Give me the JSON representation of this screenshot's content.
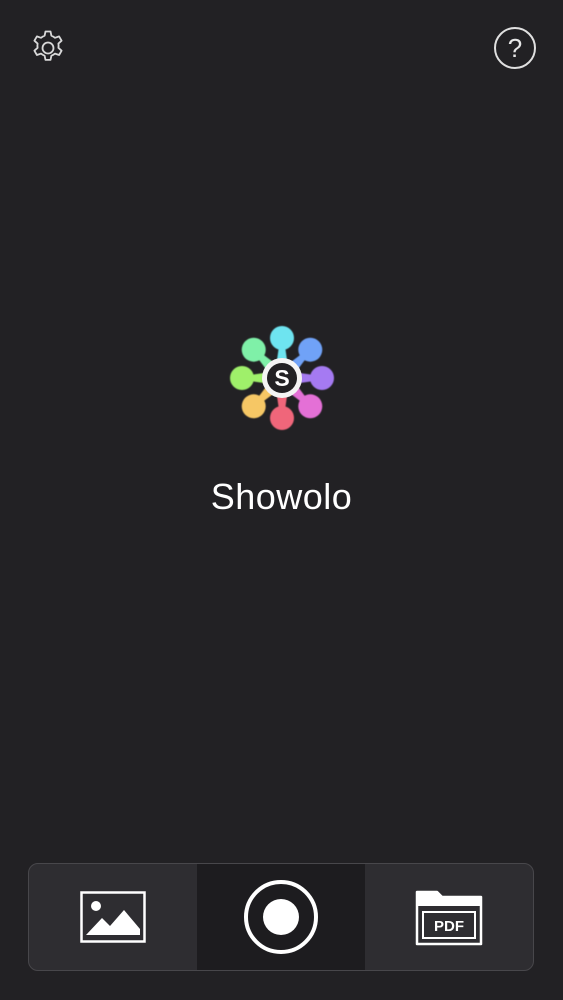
{
  "app": {
    "name": "Showolo",
    "logo_letter": "S"
  },
  "header": {
    "settings_icon": "gear-icon",
    "help_icon": "question-circle-icon",
    "help_glyph": "?"
  },
  "toolbar": {
    "items": [
      {
        "name": "photo-library",
        "icon": "image-icon"
      },
      {
        "name": "record",
        "icon": "record-icon"
      },
      {
        "name": "pdf-files",
        "icon": "pdf-folder-icon",
        "label": "PDF"
      }
    ]
  },
  "colors": {
    "background": "#222124",
    "toolbar_bg": "#2e2d31",
    "toolbar_center_bg": "#1d1c1f",
    "foreground": "#ffffff"
  }
}
